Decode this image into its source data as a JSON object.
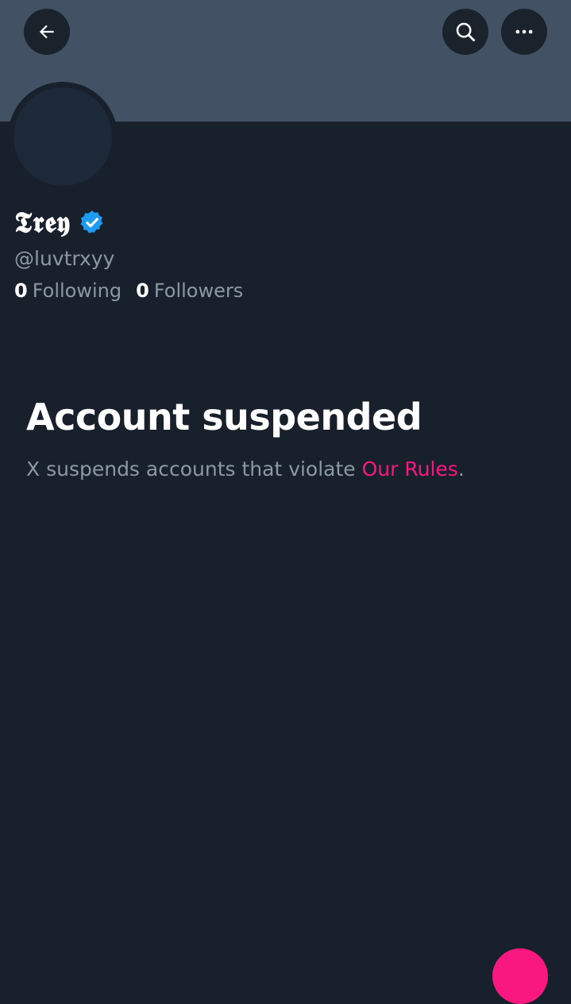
{
  "profile": {
    "display_name": "𝕿𝖗𝖊𝖞",
    "handle": "@luvtrxyy",
    "verified_icon": "verified-badge-icon",
    "following_count": "0",
    "following_label": "Following",
    "followers_count": "0",
    "followers_label": "Followers"
  },
  "header": {
    "back_icon": "arrow-left-icon",
    "search_icon": "search-icon",
    "more_icon": "more-horizontal-icon"
  },
  "suspension": {
    "title": "Account suspended",
    "message": "X suspends accounts that violate ",
    "link_text": "Our Rules",
    "suffix": "."
  },
  "colors": {
    "background": "#17202b",
    "banner": "#425163",
    "accent": "#f91880",
    "verified": "#1d9bf0",
    "secondary_text": "#8b98a5"
  }
}
